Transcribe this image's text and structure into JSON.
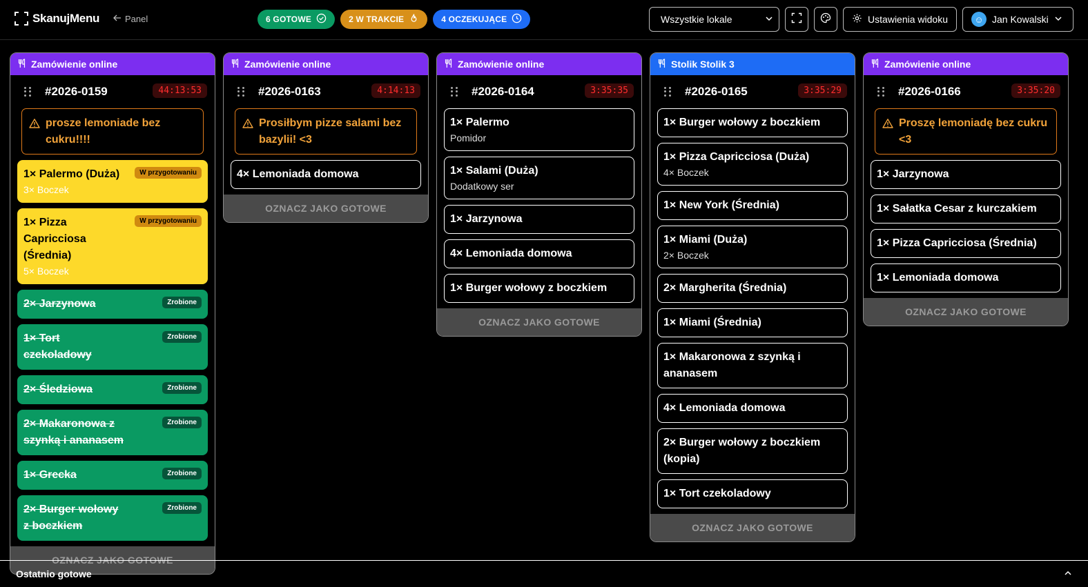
{
  "app": {
    "logo_text": "SkanujMenu",
    "back_label": "Panel"
  },
  "status": {
    "ready": "6 GOTOWE",
    "in_progress": "2 W TRAKCIE",
    "waiting": "4 OCZEKUJĄCE"
  },
  "toolbar": {
    "location_select": "Wszystkie lokale",
    "view_settings": "Ustawienia widoku",
    "user_name": "Jan Kowalski"
  },
  "orders": [
    {
      "type": "Zamówienie online",
      "header_color": "purple",
      "number": "#2026-0159",
      "timer": "44:13:53",
      "note": "prosze lemoniade bez cukru!!!!",
      "items": [
        {
          "name": "1× Palermo (Duża)",
          "sub": "3× Boczek",
          "state": "prep",
          "badge": "W przygotowaniu"
        },
        {
          "name": "1× Pizza Capricciosa (Średnia)",
          "sub": "5× Boczek",
          "state": "prep",
          "badge": "W przygotowaniu"
        },
        {
          "name": "2× Jarzynowa",
          "sub": "",
          "state": "done",
          "badge": "Zrobione"
        },
        {
          "name": "1× Tort czekoladowy",
          "sub": "",
          "state": "done",
          "badge": "Zrobione"
        },
        {
          "name": "2× Śledziowa",
          "sub": "",
          "state": "done",
          "badge": "Zrobione"
        },
        {
          "name": "2× Makaronowa z szynką i ananasem",
          "sub": "",
          "state": "done",
          "badge": "Zrobione"
        },
        {
          "name": "1× Grecka",
          "sub": "",
          "state": "done",
          "badge": "Zrobione"
        },
        {
          "name": "2× Burger wołowy z boczkiem",
          "sub": "",
          "state": "done",
          "badge": "Zrobione"
        }
      ],
      "action": "OZNACZ JAKO GOTOWE"
    },
    {
      "type": "Zamówienie online",
      "header_color": "purple",
      "number": "#2026-0163",
      "timer": "4:14:13",
      "note": "Prosiłbym pizze salami bez bazylii! <3",
      "items": [
        {
          "name": "4× Lemoniada domowa",
          "sub": "",
          "state": "new",
          "badge": ""
        }
      ],
      "action": "OZNACZ JAKO GOTOWE"
    },
    {
      "type": "Zamówienie online",
      "header_color": "purple",
      "number": "#2026-0164",
      "timer": "3:35:35",
      "note": "",
      "items": [
        {
          "name": "1× Palermo",
          "sub": "Pomidor",
          "state": "new",
          "badge": ""
        },
        {
          "name": "1× Salami (Duża)",
          "sub": "Dodatkowy ser",
          "state": "new",
          "badge": ""
        },
        {
          "name": "1× Jarzynowa",
          "sub": "",
          "state": "new",
          "badge": ""
        },
        {
          "name": "4× Lemoniada domowa",
          "sub": "",
          "state": "new",
          "badge": ""
        },
        {
          "name": "1× Burger wołowy z boczkiem",
          "sub": "",
          "state": "new",
          "badge": ""
        }
      ],
      "action": "OZNACZ JAKO GOTOWE"
    },
    {
      "type": "Stolik Stolik 3",
      "header_color": "blue",
      "number": "#2026-0165",
      "timer": "3:35:29",
      "note": "",
      "items": [
        {
          "name": "1× Burger wołowy z boczkiem",
          "sub": "",
          "state": "new",
          "badge": ""
        },
        {
          "name": "1× Pizza Capricciosa (Duża)",
          "sub": "4× Boczek",
          "state": "new",
          "badge": ""
        },
        {
          "name": "1× New York (Średnia)",
          "sub": "",
          "state": "new",
          "badge": ""
        },
        {
          "name": "1× Miami (Duża)",
          "sub": "2× Boczek",
          "state": "new",
          "badge": ""
        },
        {
          "name": "2× Margherita (Średnia)",
          "sub": "",
          "state": "new",
          "badge": ""
        },
        {
          "name": "1× Miami (Średnia)",
          "sub": "",
          "state": "new",
          "badge": ""
        },
        {
          "name": "1× Makaronowa z szynką i ananasem",
          "sub": "",
          "state": "new",
          "badge": ""
        },
        {
          "name": "4× Lemoniada domowa",
          "sub": "",
          "state": "new",
          "badge": ""
        },
        {
          "name": "2× Burger wołowy z boczkiem (kopia)",
          "sub": "",
          "state": "new",
          "badge": ""
        },
        {
          "name": "1× Tort czekoladowy",
          "sub": "",
          "state": "new",
          "badge": ""
        }
      ],
      "action": "OZNACZ JAKO GOTOWE"
    },
    {
      "type": "Zamówienie online",
      "header_color": "purple",
      "number": "#2026-0166",
      "timer": "3:35:20",
      "note": "Proszę lemoniadę bez cukru <3",
      "items": [
        {
          "name": "1× Jarzynowa",
          "sub": "",
          "state": "new",
          "badge": ""
        },
        {
          "name": "1× Sałatka Cesar z kurczakiem",
          "sub": "",
          "state": "new",
          "badge": ""
        },
        {
          "name": "1× Pizza Capricciosa (Średnia)",
          "sub": "",
          "state": "new",
          "badge": ""
        },
        {
          "name": "1× Lemoniada domowa",
          "sub": "",
          "state": "new",
          "badge": ""
        }
      ],
      "action": "OZNACZ JAKO GOTOWE"
    }
  ],
  "footer": {
    "recent_ready": "Ostatnio gotowe"
  },
  "colors": {
    "ready": "#0a9a62",
    "in_progress": "#d8901a",
    "waiting": "#1e6cf5",
    "online_header": "#7c2ef0",
    "table_header": "#1e6cf5",
    "prep_item": "#fdd92a",
    "done_item": "#0a9a62",
    "timer_text": "#ff2d2d",
    "note_border": "#e07a1a"
  }
}
